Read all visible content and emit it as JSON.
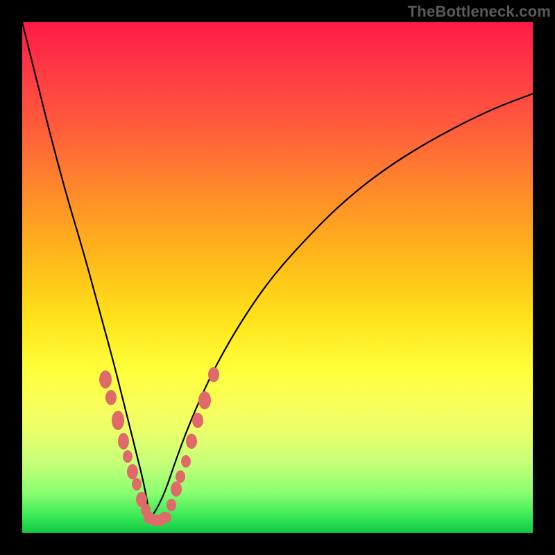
{
  "watermark": "TheBottleneck.com",
  "colors": {
    "frame": "#000000",
    "curve_stroke": "#000000",
    "blob_fill": "#e06a6a",
    "gradient_top": "#ff1a47",
    "gradient_bottom": "#12c742"
  },
  "chart_data": {
    "type": "line",
    "title": "",
    "xlabel": "",
    "ylabel": "",
    "xlim": [
      0,
      100
    ],
    "ylim": [
      0,
      100
    ],
    "notes": "V-shaped bottleneck curve. 0 on y = best (green, bottom). Minimum around x≈25. Axes unlabeled; values are estimated from pixel positions on a 0–100 normalized scale.",
    "series": [
      {
        "name": "bottleneck-curve",
        "x": [
          0,
          3,
          6,
          9,
          12,
          15,
          18,
          20,
          22,
          24,
          25,
          26,
          28,
          30,
          33,
          37,
          42,
          48,
          55,
          63,
          72,
          82,
          92,
          100
        ],
        "y": [
          100,
          88,
          76,
          65,
          55,
          44,
          33,
          25,
          17,
          9,
          3,
          4,
          8,
          14,
          22,
          31,
          40,
          49,
          57,
          65,
          72,
          78,
          83,
          86
        ]
      }
    ],
    "annotations_scatter": {
      "name": "highlighted-points",
      "comment": "Salmon blobs clustered near the curve minimum, sizes in px (w,h).",
      "points": [
        {
          "x": 16.3,
          "y": 30.0,
          "w": 18,
          "h": 26
        },
        {
          "x": 17.4,
          "y": 26.5,
          "w": 16,
          "h": 22
        },
        {
          "x": 18.8,
          "y": 22.0,
          "w": 18,
          "h": 28
        },
        {
          "x": 19.8,
          "y": 18.0,
          "w": 16,
          "h": 24
        },
        {
          "x": 20.6,
          "y": 15.0,
          "w": 14,
          "h": 18
        },
        {
          "x": 21.6,
          "y": 12.0,
          "w": 16,
          "h": 22
        },
        {
          "x": 22.4,
          "y": 9.5,
          "w": 14,
          "h": 18
        },
        {
          "x": 23.4,
          "y": 6.5,
          "w": 16,
          "h": 22
        },
        {
          "x": 24.2,
          "y": 4.5,
          "w": 14,
          "h": 18
        },
        {
          "x": 25.0,
          "y": 2.8,
          "w": 18,
          "h": 16
        },
        {
          "x": 26.5,
          "y": 2.5,
          "w": 24,
          "h": 16
        },
        {
          "x": 28.0,
          "y": 3.0,
          "w": 18,
          "h": 16
        },
        {
          "x": 29.2,
          "y": 5.5,
          "w": 14,
          "h": 18
        },
        {
          "x": 30.2,
          "y": 8.5,
          "w": 16,
          "h": 22
        },
        {
          "x": 31.0,
          "y": 11.0,
          "w": 14,
          "h": 18
        },
        {
          "x": 32.0,
          "y": 14.0,
          "w": 14,
          "h": 18
        },
        {
          "x": 33.2,
          "y": 18.0,
          "w": 16,
          "h": 22
        },
        {
          "x": 34.4,
          "y": 22.0,
          "w": 16,
          "h": 22
        },
        {
          "x": 35.8,
          "y": 26.0,
          "w": 18,
          "h": 26
        },
        {
          "x": 37.5,
          "y": 31.0,
          "w": 16,
          "h": 22
        }
      ]
    }
  }
}
